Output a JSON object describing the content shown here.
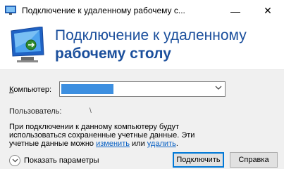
{
  "window": {
    "title": "Подключение к удаленному рабочему с...",
    "minimize_glyph": "—",
    "close_glyph": "✕"
  },
  "header": {
    "line1": "Подключение к удаленному",
    "line2": "рабочему столу"
  },
  "form": {
    "computer_label_prefix": "К",
    "computer_label_rest": "омпьютер:",
    "computer_value": "",
    "user_label": "Пользователь:",
    "user_value": "\\"
  },
  "info": {
    "text_before": "При подключении к данному компьютеру будут использоваться сохраненные учетные данные. Эти учетные данные можно ",
    "link_change": "изменить",
    "text_mid": " или ",
    "link_delete": "удалить",
    "text_end": "."
  },
  "footer": {
    "show_options": "Показать параметры",
    "connect_button": "Подключить",
    "help_button": "Справка"
  },
  "icons": {
    "app": "remote-desktop-icon",
    "logo": "remote-desktop-logo-icon",
    "dropdown": "chevron-down-icon",
    "expand": "chevron-down-circle-icon"
  },
  "colors": {
    "heading": "#1b4f9c",
    "link": "#0b62c4",
    "default_button_border": "#0078d7",
    "selection": "#3d8fe0"
  }
}
